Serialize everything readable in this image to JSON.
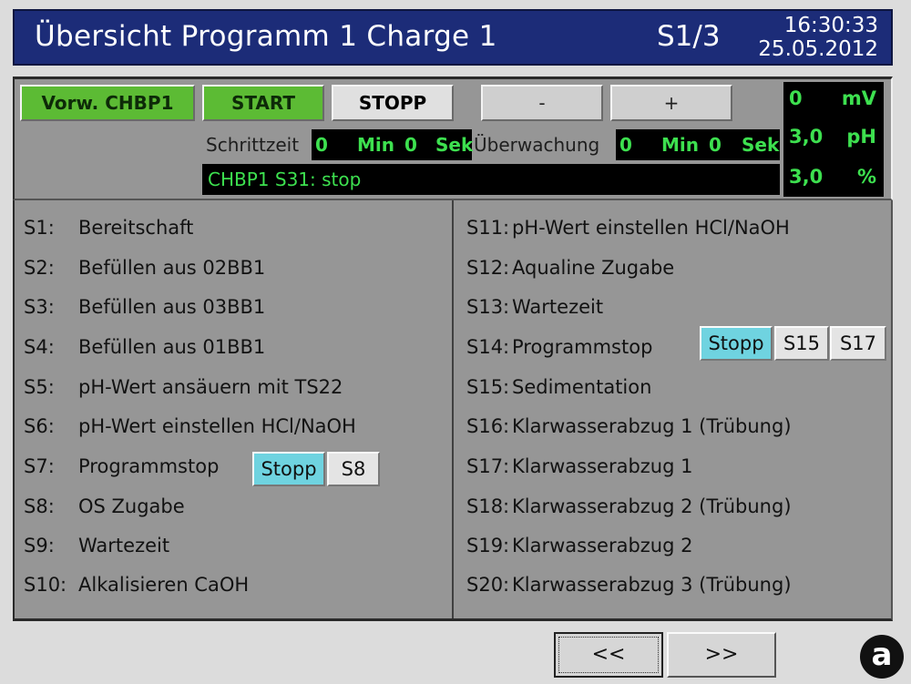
{
  "header": {
    "title": "Übersicht Programm 1 Charge 1",
    "page": "S1/3",
    "time": "16:30:33",
    "date": "25.05.2012"
  },
  "controls": {
    "program_button": "Vorw. CHBP1",
    "start_button": "START",
    "stop_button": "STOPP",
    "minus_button": "-",
    "plus_button": "+",
    "step_time_label": "Schrittzeit",
    "step_time_min": "0",
    "step_time_min_unit": "Min",
    "step_time_sec": "0",
    "step_time_sec_unit": "Sek",
    "monitoring_label": "Überwachung",
    "monitoring_min": "0",
    "monitoring_min_unit": "Min",
    "monitoring_sec": "0",
    "monitoring_sec_unit": "Sek",
    "status_text": "CHBP1 S31: stop"
  },
  "measurements": [
    {
      "value": "0",
      "unit": "mV"
    },
    {
      "value": "3,0",
      "unit": "pH"
    },
    {
      "value": "3,0",
      "unit": "%"
    }
  ],
  "steps_left": [
    {
      "code": "S1:",
      "label": "Bereitschaft"
    },
    {
      "code": "S2:",
      "label": "Befüllen aus 02BB1"
    },
    {
      "code": "S3:",
      "label": "Befüllen aus 03BB1"
    },
    {
      "code": "S4:",
      "label": "Befüllen aus 01BB1"
    },
    {
      "code": "S5:",
      "label": "pH-Wert ansäuern mit TS22"
    },
    {
      "code": "S6:",
      "label": "pH-Wert einstellen HCl/NaOH"
    },
    {
      "code": "S7:",
      "label": "Programmstop"
    },
    {
      "code": "S8:",
      "label": "OS Zugabe"
    },
    {
      "code": "S9:",
      "label": "Wartezeit"
    },
    {
      "code": "S10:",
      "label": "Alkalisieren CaOH"
    }
  ],
  "steps_right": [
    {
      "code": "S11:",
      "label": "pH-Wert einstellen HCl/NaOH"
    },
    {
      "code": "S12:",
      "label": "Aqualine Zugabe"
    },
    {
      "code": "S13:",
      "label": "Wartezeit"
    },
    {
      "code": "S14:",
      "label": "Programmstop"
    },
    {
      "code": "S15:",
      "label": "Sedimentation"
    },
    {
      "code": "S16:",
      "label": "Klarwasserabzug 1 (Trübung)"
    },
    {
      "code": "S17:",
      "label": "Klarwasserabzug 1"
    },
    {
      "code": "S18:",
      "label": "Klarwasserabzug 2 (Trübung)"
    },
    {
      "code": "S19:",
      "label": "Klarwasserabzug 2"
    },
    {
      "code": "S20:",
      "label": "Klarwasserabzug 3 (Trübung)"
    }
  ],
  "s7_buttons": {
    "stop": "Stopp",
    "next": "S8"
  },
  "s14_buttons": {
    "stop": "Stopp",
    "next1": "S15",
    "next2": "S17"
  },
  "nav": {
    "prev": "<<",
    "next": ">>"
  },
  "badge": "a",
  "colors": {
    "title_bar": "#1c2c78",
    "panel": "#969696",
    "lcd_text": "#3de04f",
    "green_button": "#5cbb34",
    "cyan_button": "#6fd3e0"
  }
}
